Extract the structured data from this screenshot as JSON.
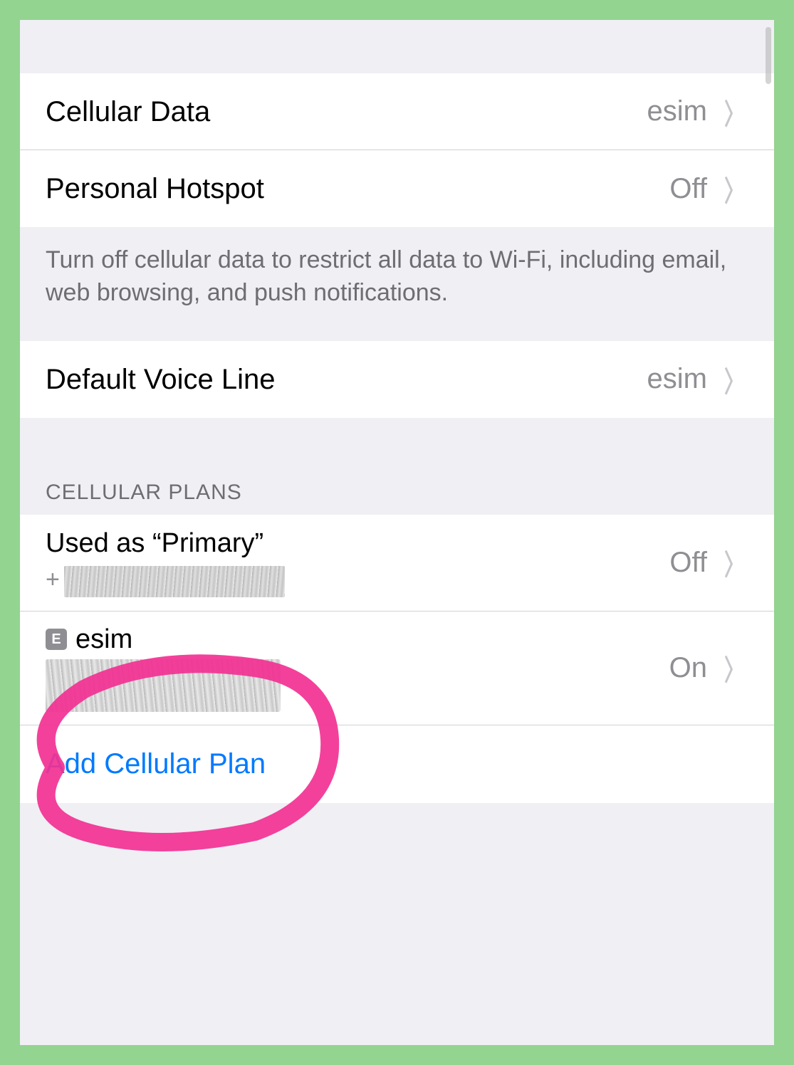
{
  "section1": {
    "cellular_data": {
      "label": "Cellular Data",
      "value": "esim"
    },
    "personal_hotspot": {
      "label": "Personal Hotspot",
      "value": "Off"
    },
    "footer": "Turn off cellular data to restrict all data to Wi-Fi, including email, web browsing, and push notifications."
  },
  "section2": {
    "default_voice_line": {
      "label": "Default Voice Line",
      "value": "esim"
    }
  },
  "plans": {
    "header": "CELLULAR PLANS",
    "primary": {
      "title": "Used as “Primary”",
      "sub_prefix": "+",
      "value": "Off"
    },
    "esim": {
      "badge": "E",
      "title": "esim",
      "value": "On"
    },
    "add": {
      "label": "Add Cellular Plan"
    }
  }
}
